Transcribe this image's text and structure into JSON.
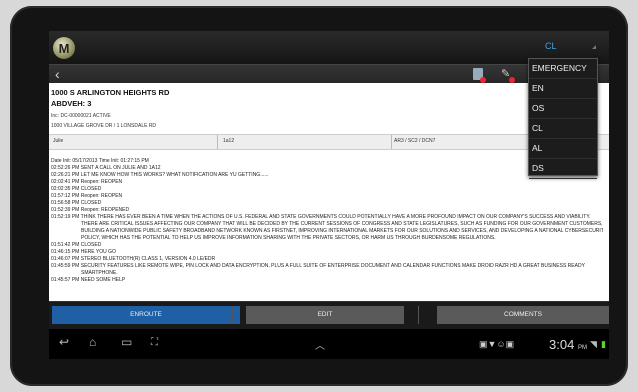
{
  "app": {
    "logo_glyph": "M",
    "status_top": "CL",
    "back_glyph": "‹"
  },
  "incident": {
    "address": "1000 S ARLINGTON HEIGHTS RD",
    "vehicles": "ABDVEH:  3",
    "inc_line": "Inc:  DC-00000021     ACTIVE",
    "cross_street": "1000 VILLAGE GROVE DR / 1 LONSDALE RD"
  },
  "unit_row": {
    "name": "Julie",
    "unit": "1a12",
    "status": "AR3 / SC2 / DCN7"
  },
  "log": [
    "Date Init:  05/17/2013    Time Init:  01:27:15 PM",
    "02:52:26 PM SENT A CALL ON JULIE AND 1A12",
    "02:26:21 PM LET ME KNOW HOW THIS WORKS? WHAT NOTIFICATION ARE YU GETTING......",
    "02:02:41 PM Reopen: REOPEN",
    "02:02:35 PM CLOSED",
    "01:57:12 PM Reopen: REOPEN",
    "01:56:58 PM CLOSED",
    "01:52:39 PM Reopen: REOPENED",
    "01:52:19 PM THINK THERE HAS EVER BEEN A TIME WHEN THE ACTIONS OF U.S. FEDERAL AND STATE GOVERNMENTS COULD POTENTIALLY HAVE A MORE PROFOUND IMPACT ON OUR COMPANY'S SUCCESS AND VIABILITY.",
    "THERE ARE CRITICAL ISSUES AFFECTING OUR COMPANY THAT WILL BE DECIDED BY THE CURRENT SESSIONS OF CONGRESS AND STATE LEGISLATURES, SUCH AS FUNDING FOR OUR GOVERNMENT CUSTOMERS,",
    "BUILDING A NATIONWIDE PUBLIC SAFETY BROADBAND NETWORK KNOWN AS FIRSTNET, IMPROVING INTERNATIONAL MARKETS FOR OUR SOLUTIONS AND SERVICES, AND DEVELOPING A NATIONAL CYBERSECURITY",
    "POLICY, WHICH HAS THE POTENTIAL TO HELP US IMPROVE INFORMATION SHARING WITH THE PRIVATE SECTORS, OR HARM US THROUGH BURDENSOME REGULATIONS.",
    "01:51:42 PM CLOSED",
    "01:46:15 PM HERE YOU GO",
    "01:46:07 PM STEREO BLUETOOTH(R) CLASS 1, VERSION 4.0 LE/EDR",
    "01:45:59 PM SECURITY FEATURES LIKE REMOTE WIPE, PIN LOCK AND DATA ENCRYPTION, PLUS A FULL SUITE OF ENTERPRISE DOCUMENT AND CALENDAR FUNCTIONS MAKE DROID RAZR HD A GREAT BUSINESS READY",
    "SMARTPHONE.",
    "01:45:57 PM NEED SOME HELP"
  ],
  "dropdown": [
    "EMERGENCY",
    "EN",
    "OS",
    "CL",
    "AL",
    "DS"
  ],
  "actions": {
    "enroute": "ENROUTE",
    "edit": "EDIT",
    "comments": "COMMENTS"
  },
  "system": {
    "time": "3:04",
    "ampm": "PM"
  },
  "colors": {
    "accent": "#3aa6e6",
    "enroute_bg": "#1e5fa6",
    "button_bg": "#5a5a5a"
  }
}
